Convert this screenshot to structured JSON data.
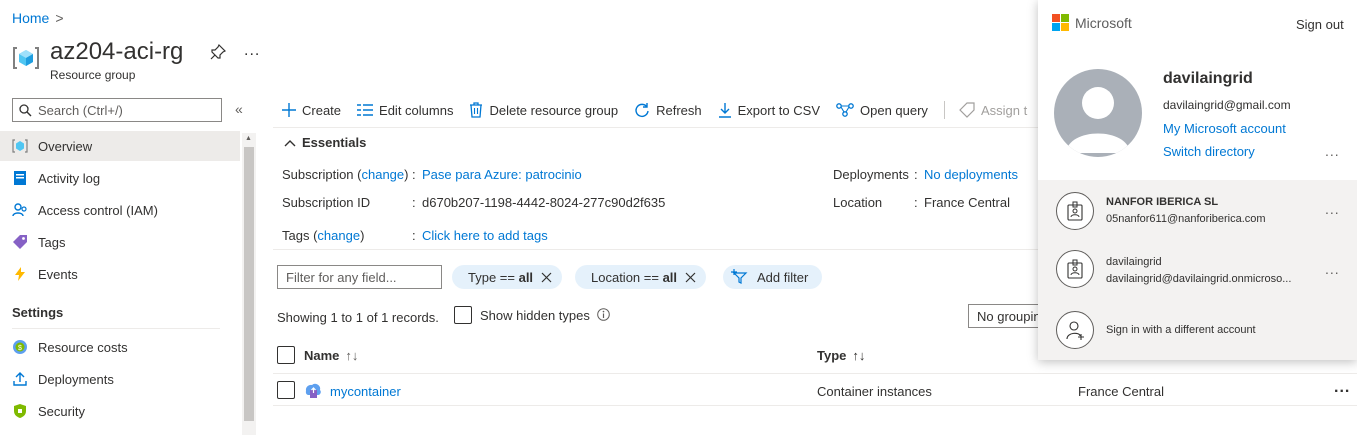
{
  "breadcrumb": {
    "home": "Home",
    "chevron": ">"
  },
  "resource": {
    "title": "az204-aci-rg",
    "subtitle": "Resource group",
    "more": "..."
  },
  "sidebar": {
    "search_placeholder": "Search (Ctrl+/)",
    "collapse": "«",
    "items": [
      {
        "label": "Overview",
        "icon": "overview-icon"
      },
      {
        "label": "Activity log",
        "icon": "activity-log-icon"
      },
      {
        "label": "Access control (IAM)",
        "icon": "iam-icon"
      },
      {
        "label": "Tags",
        "icon": "tag-icon"
      },
      {
        "label": "Events",
        "icon": "lightning-icon"
      }
    ],
    "settings_header": "Settings",
    "settings_items": [
      {
        "label": "Resource costs",
        "icon": "cost-icon"
      },
      {
        "label": "Deployments",
        "icon": "upload-icon"
      },
      {
        "label": "Security",
        "icon": "shield-icon"
      }
    ]
  },
  "toolbar": {
    "create": "Create",
    "edit_columns": "Edit columns",
    "delete": "Delete resource group",
    "refresh": "Refresh",
    "export": "Export to CSV",
    "open_query": "Open query",
    "assign": "Assign t"
  },
  "essentials": {
    "title": "Essentials",
    "subscription_label": "Subscription (",
    "subscription_change": "change",
    "subscription_label_end": ")",
    "sep": ":",
    "subscription_value": "Pase para Azure: patrocinio",
    "subscription_id_label": "Subscription ID",
    "subscription_id_value": "d670b207-1198-4442-8024-277c90d2f635",
    "tags_label": "Tags (",
    "tags_change": "change",
    "tags_label_end": ")",
    "tags_value": "Click here to add tags",
    "deployments_label": "Deployments",
    "deployments_value": "No deployments",
    "location_label": "Location",
    "location_value": "France Central"
  },
  "filters": {
    "placeholder": "Filter for any field...",
    "type_pill": {
      "key": "Type == ",
      "val": "all"
    },
    "location_pill": {
      "key": "Location == ",
      "val": "all"
    },
    "add_filter": "Add filter"
  },
  "records": {
    "showing": "Showing 1 to 1 of 1 records.",
    "show_hidden": "Show hidden types",
    "grouping": "No grouping"
  },
  "table": {
    "columns": [
      "Name",
      "Type"
    ],
    "sort_glyph": "↑↓",
    "rows": [
      {
        "name": "mycontainer",
        "type": "Container instances",
        "location": "France Central"
      }
    ]
  },
  "account": {
    "brand": "Microsoft",
    "sign_out": "Sign out",
    "name": "davilaingrid",
    "email": "davilaingrid@gmail.com",
    "my_account": "My Microsoft account",
    "switch_directory": "Switch directory",
    "more": "...",
    "directories": [
      {
        "name": "NANFOR IBERICA SL",
        "email": "05nanfor611@nanforiberica.com"
      },
      {
        "name": "davilaingrid",
        "email": "davilaingrid@davilaingrid.onmicroso..."
      }
    ],
    "sign_in_other": "Sign in with a different account"
  },
  "colors": {
    "accent": "#0078d4",
    "pill_bg": "#e5f1fb",
    "ms_red": "#f25022",
    "ms_green": "#7fba00",
    "ms_blue": "#00a4ef",
    "ms_yellow": "#ffb900"
  }
}
